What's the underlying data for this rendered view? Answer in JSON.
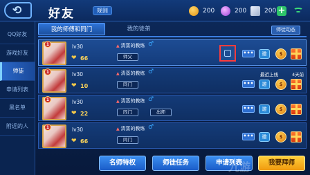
{
  "header": {
    "title": "好友",
    "rules_label": "规则",
    "currencies": [
      {
        "name": "gold-coin",
        "value": "200",
        "color": "#f2b23a"
      },
      {
        "name": "diamond",
        "value": "200",
        "color": "#d070f0"
      },
      {
        "name": "voucher",
        "value": "200",
        "color": "#c7d4ea"
      }
    ]
  },
  "sidebar": {
    "items": [
      {
        "label": "QQ好友",
        "active": false
      },
      {
        "label": "游戏好友",
        "active": false
      },
      {
        "label": "师徒",
        "active": true
      },
      {
        "label": "申请列表",
        "active": false
      },
      {
        "label": "黑名单",
        "active": false
      },
      {
        "label": "附近的人",
        "active": false
      }
    ]
  },
  "tabs": [
    {
      "label": "我的师傅和同门",
      "active": true
    },
    {
      "label": "我的徒弟",
      "active": false
    }
  ],
  "feed_button": "师徒动态",
  "rows": [
    {
      "rank": "1",
      "level": "lv30",
      "intimacy": "66",
      "name": "清蒸的教练",
      "relations": [
        "师父"
      ],
      "last_online_label": "",
      "last_online_value": "",
      "selected": true
    },
    {
      "rank": "1",
      "level": "lv30",
      "intimacy": "10",
      "name": "清蒸的教练",
      "relations": [
        "同门"
      ],
      "last_online_label": "最近上线",
      "last_online_value": "4天前",
      "selected": false
    },
    {
      "rank": "1",
      "level": "lv30",
      "intimacy": "22",
      "name": "清蒸的教练",
      "relations": [
        "同门",
        "出师"
      ],
      "last_online_label": "",
      "last_online_value": "",
      "selected": false
    },
    {
      "rank": "1",
      "level": "lv30",
      "intimacy": "66",
      "name": "清蒸的教练",
      "relations": [
        "同门"
      ],
      "last_online_label": "",
      "last_online_value": "",
      "selected": false
    }
  ],
  "row_actions": {
    "more": "•••",
    "invite": "邀",
    "coin": "$"
  },
  "bottom": {
    "privilege": "名师特权",
    "tasks": "师徒任务",
    "apply_list": "申请列表",
    "find_master": "我要拜师"
  },
  "watermark": "九游"
}
